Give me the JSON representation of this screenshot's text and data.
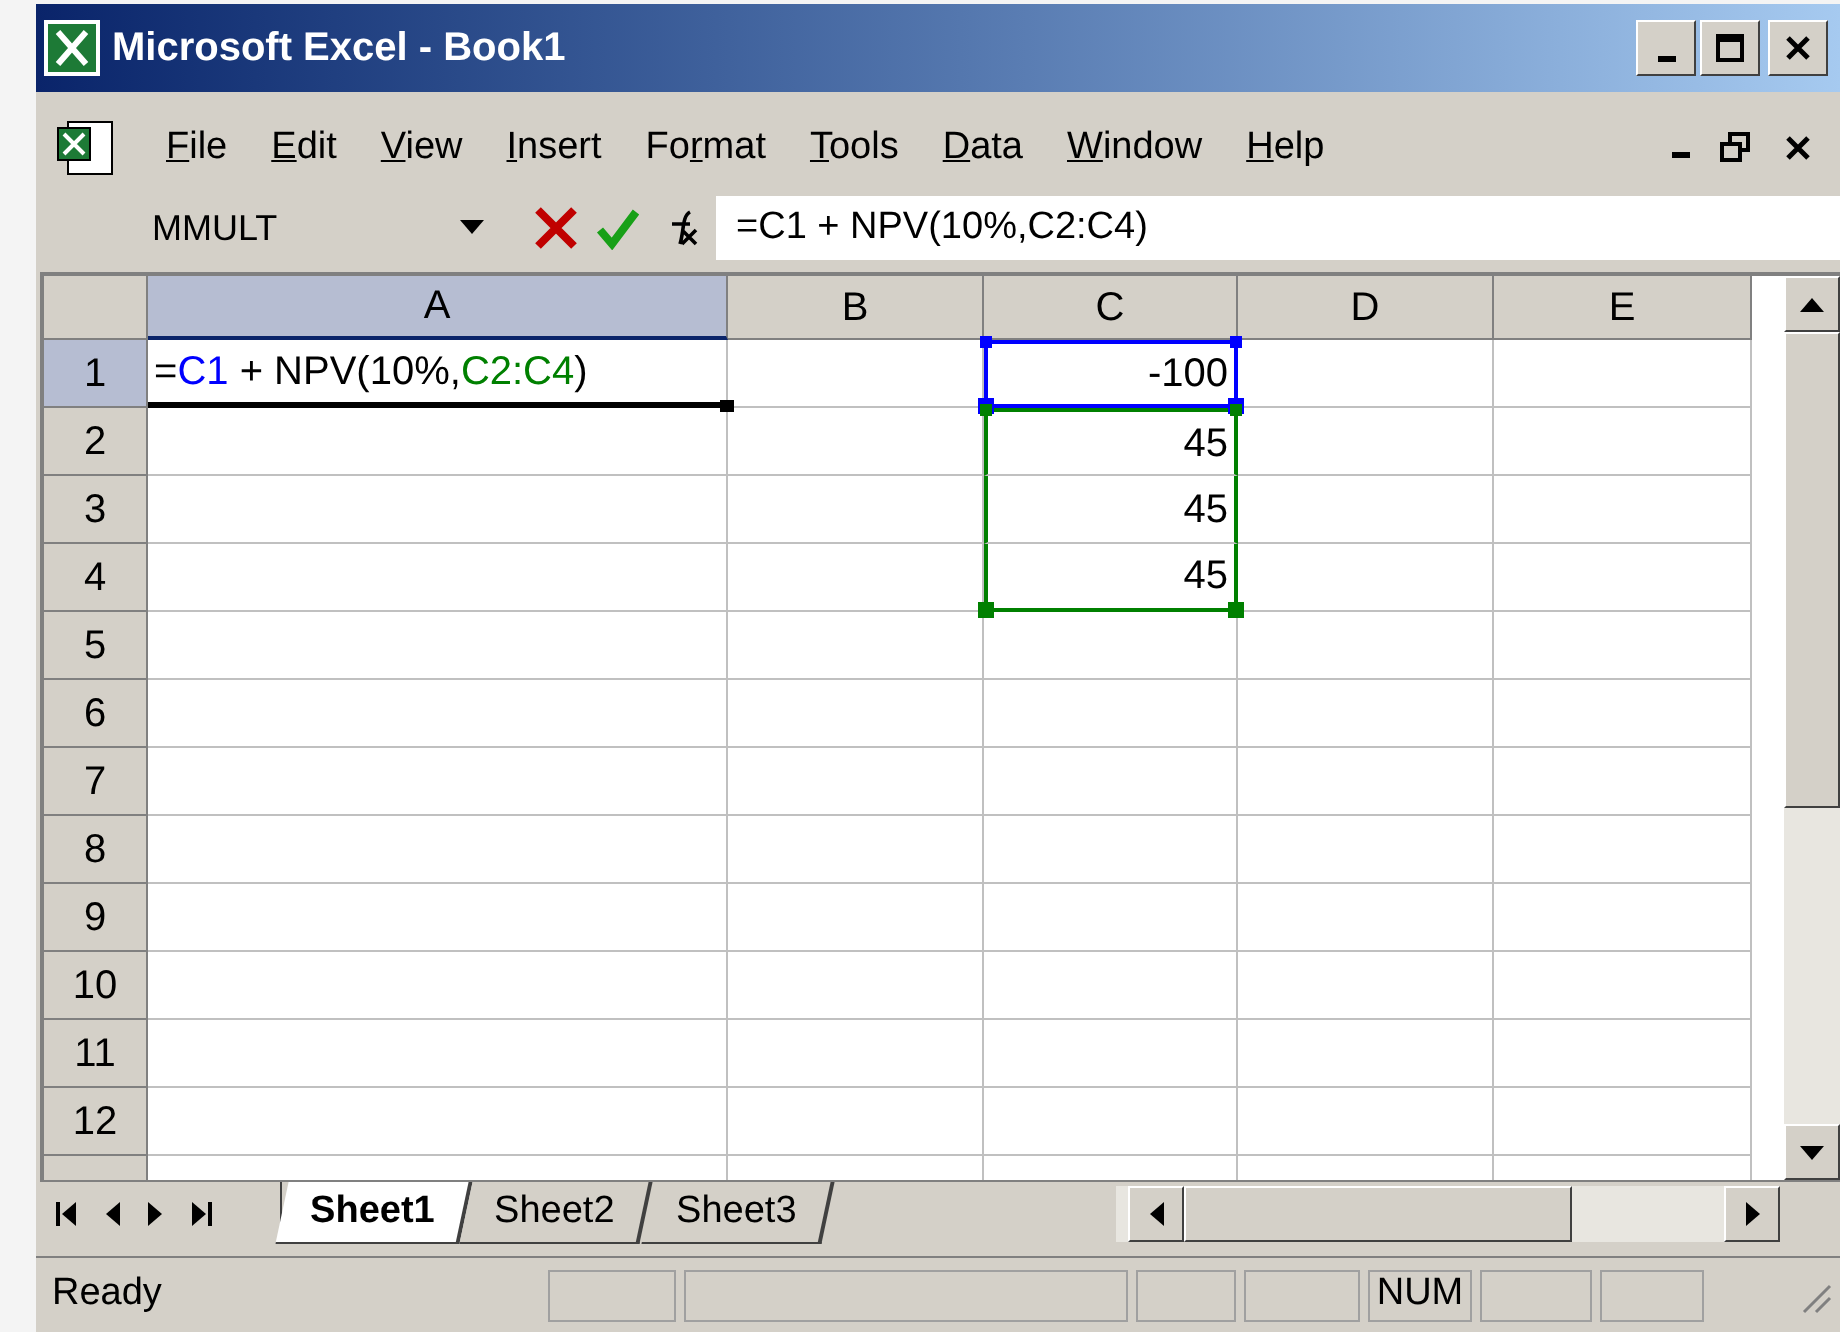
{
  "window": {
    "title": "Microsoft Excel - Book1"
  },
  "menu": [
    {
      "key": "F",
      "rest": "ile"
    },
    {
      "key": "E",
      "rest": "dit"
    },
    {
      "key": "V",
      "rest": "iew"
    },
    {
      "key": "I",
      "rest": "nsert"
    },
    {
      "lead": "Fo",
      "key": "r",
      "rest": "mat"
    },
    {
      "key": "T",
      "rest": "ools"
    },
    {
      "key": "D",
      "rest": "ata"
    },
    {
      "key": "W",
      "rest": "indow"
    },
    {
      "key": "H",
      "rest": "elp"
    }
  ],
  "formula_bar": {
    "name_box": "MMULT",
    "formula": "=C1 + NPV(10%,C2:C4)"
  },
  "columns": [
    {
      "label": "A",
      "selected": true
    },
    {
      "label": "B",
      "selected": false
    },
    {
      "label": "C",
      "selected": false
    },
    {
      "label": "D",
      "selected": false
    },
    {
      "label": "E",
      "selected": false
    }
  ],
  "rows": [
    {
      "label": "1",
      "selected": true,
      "cells": [
        {
          "editing": true,
          "segments": [
            {
              "text": "=",
              "color": "#000000"
            },
            {
              "text": "C1",
              "color": "#0000ff"
            },
            {
              "text": " + NPV(10%,",
              "color": "#000000"
            },
            {
              "text": "C2:C4",
              "color": "#008000"
            },
            {
              "text": ")",
              "color": "#000000"
            }
          ]
        },
        {},
        {
          "value": "-100",
          "color": "#0000ff"
        },
        {},
        {}
      ]
    },
    {
      "label": "2",
      "selected": false,
      "cells": [
        {},
        {},
        {
          "value": "45",
          "color": "#008000"
        },
        {},
        {}
      ]
    },
    {
      "label": "3",
      "selected": false,
      "cells": [
        {},
        {},
        {
          "value": "45",
          "color": "#008000"
        },
        {},
        {}
      ]
    },
    {
      "label": "4",
      "selected": false,
      "cells": [
        {},
        {},
        {
          "value": "45",
          "color": "#008000"
        },
        {},
        {}
      ]
    },
    {
      "label": "5",
      "selected": false,
      "cells": [
        {},
        {},
        {},
        {},
        {}
      ]
    },
    {
      "label": "6",
      "selected": false,
      "cells": [
        {},
        {},
        {},
        {},
        {}
      ]
    },
    {
      "label": "7",
      "selected": false,
      "cells": [
        {},
        {},
        {},
        {},
        {}
      ]
    },
    {
      "label": "8",
      "selected": false,
      "cells": [
        {},
        {},
        {},
        {},
        {}
      ]
    },
    {
      "label": "9",
      "selected": false,
      "cells": [
        {},
        {},
        {},
        {},
        {}
      ]
    },
    {
      "label": "10",
      "selected": false,
      "cells": [
        {},
        {},
        {},
        {},
        {}
      ]
    },
    {
      "label": "11",
      "selected": false,
      "cells": [
        {},
        {},
        {},
        {},
        {}
      ]
    },
    {
      "label": "12",
      "selected": false,
      "cells": [
        {},
        {},
        {},
        {},
        {}
      ]
    }
  ],
  "sheet_tabs": [
    {
      "label": "Sheet1",
      "selected": true
    },
    {
      "label": "Sheet2",
      "selected": false
    },
    {
      "label": "Sheet3",
      "selected": false
    }
  ],
  "status_bar": {
    "mode": "Ready",
    "indicators": [
      "NUM"
    ]
  }
}
